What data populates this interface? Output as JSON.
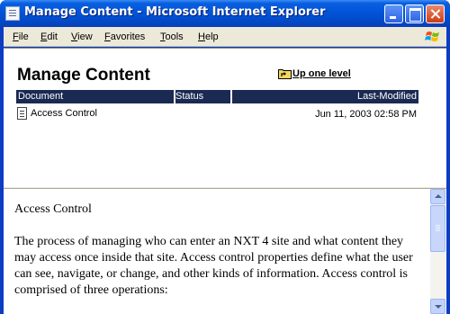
{
  "window": {
    "title": "Manage Content - Microsoft Internet Explorer",
    "icon": "document-icon"
  },
  "menubar": {
    "items": [
      "File",
      "Edit",
      "View",
      "Favorites",
      "Tools",
      "Help"
    ]
  },
  "top_pane": {
    "title": "Manage Content",
    "up_link": "Up one level",
    "table": {
      "columns": [
        "Document",
        "Status",
        "Last-Modified"
      ],
      "rows": [
        {
          "document": "Access Control",
          "status": "",
          "last_modified": "Jun 11, 2003 02:58 PM"
        }
      ]
    }
  },
  "bottom_pane": {
    "heading": "Access Control",
    "body": "The process of managing who can enter an NXT 4 site and what content they may access once inside that site. Access control properties define what the user can see, navigate, or change, and other kinds of information. Access control is comprised of three operations:"
  },
  "colors": {
    "table_header_bg": "#1b2a52",
    "title_bar": "#0254d8",
    "menubar_bg": "#ece9d8"
  }
}
